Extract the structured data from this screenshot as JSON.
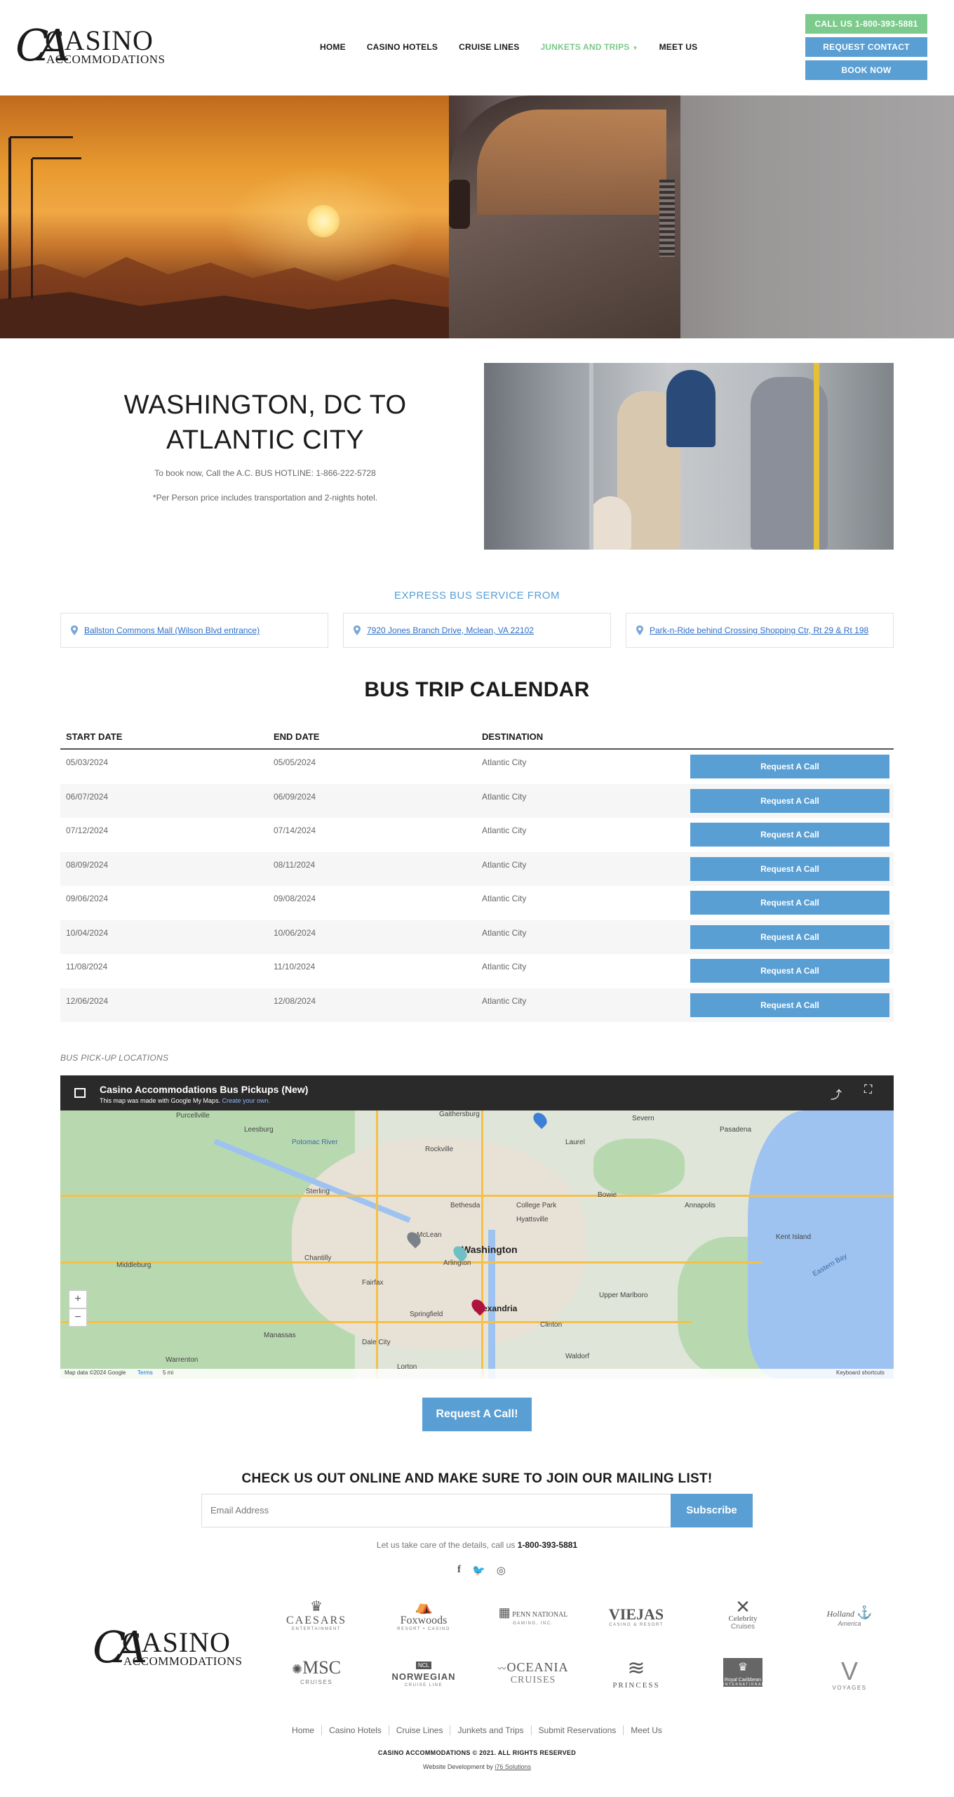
{
  "header": {
    "logo_mark": "CA",
    "logo_casino": "CASINO",
    "logo_accommodations": "ACCOMMODATIONS",
    "nav": [
      {
        "label": "HOME"
      },
      {
        "label": "CASINO HOTELS"
      },
      {
        "label": "CRUISE LINES"
      },
      {
        "label": "JUNKETS AND TRIPS"
      },
      {
        "label": "MEET US"
      }
    ],
    "call_label": "CALL US 1-800-393-5881",
    "request_label": "REQUEST CONTACT",
    "book_label": "BOOK NOW",
    "active_color": "#7cc98a"
  },
  "intro": {
    "title": "WASHINGTON, DC TO ATLANTIC CITY",
    "hotline": "To book now, Call the A.C. BUS HOTLINE: 1-866-222-5728",
    "note": "*Per Person price includes transportation and 2-nights hotel."
  },
  "express": {
    "heading": "EXPRESS BUS SERVICE FROM",
    "locations": [
      "Ballston Commons Mall (Wilson Blvd entrance)",
      "7920 Jones Branch Drive, Mclean, VA 22102",
      "Park-n-Ride behind Crossing Shopping Ctr, Rt 29 & Rt 198"
    ]
  },
  "calendar": {
    "title": "BUS TRIP CALENDAR",
    "headers": [
      "START DATE",
      "END DATE",
      "DESTINATION"
    ],
    "button_label": "Request A Call",
    "rows": [
      [
        "05/03/2024",
        "05/05/2024",
        "Atlantic City"
      ],
      [
        "06/07/2024",
        "06/09/2024",
        "Atlantic City"
      ],
      [
        "07/12/2024",
        "07/14/2024",
        "Atlantic City"
      ],
      [
        "08/09/2024",
        "08/11/2024",
        "Atlantic City"
      ],
      [
        "09/06/2024",
        "09/08/2024",
        "Atlantic City"
      ],
      [
        "10/04/2024",
        "10/06/2024",
        "Atlantic City"
      ],
      [
        "11/08/2024",
        "11/10/2024",
        "Atlantic City"
      ],
      [
        "12/06/2024",
        "12/08/2024",
        "Atlantic City"
      ]
    ]
  },
  "map": {
    "label": "BUS PICK-UP LOCATIONS",
    "title": "Casino Accommodations Bus Pickups (New)",
    "subtitle_prefix": "This map was made with Google My Maps.",
    "subtitle_link": "Create your own.",
    "footer_data": "Map data ©2024 Google",
    "footer_terms": "Terms",
    "footer_scale": "5 mi",
    "footer_shortcuts": "Keyboard shortcuts",
    "places": {
      "washington": "Washington",
      "arlington": "Arlington",
      "alexandria": "Alexandria",
      "mclean": "McLean",
      "bethesda": "Bethesda",
      "rockville": "Rockville",
      "gaithersburg": "Gaithersburg",
      "leesburg": "Leesburg",
      "laurel": "Laurel",
      "annapolis": "Annapolis",
      "columbia": "College Park",
      "bowie": "Bowie",
      "fairfax": "Fairfax",
      "springfield": "Springfield",
      "manassas": "Manassas",
      "potomac_river": "Potomac River",
      "severn": "Severn",
      "pasadena": "Pasadena",
      "chantilly": "Chantilly",
      "reston": "Sterling",
      "clinton": "Clinton",
      "waldorf": "Waldorf",
      "eastern_bay": "Eastern Bay",
      "kent_island": "Kent Island",
      "upper_marlboro": "Upper Marlboro",
      "purcellville": "Purcellville",
      "middleburg": "Middleburg",
      "warrenton": "Warrenton",
      "dale_city": "Dale City",
      "lorton": "Lorton",
      "silver_spring": "Hyattsville"
    }
  },
  "cta": {
    "label": "Request A Call!"
  },
  "mailing": {
    "heading": "CHECK US OUT ONLINE AND MAKE SURE TO JOIN OUR MAILING LIST!",
    "placeholder": "Email Address",
    "button": "Subscribe",
    "note_prefix": "Let us take care of the details, call us",
    "phone": "1-800-393-5881"
  },
  "partners": [
    {
      "name": "CAESARS",
      "sub": "ENTERTAINMENT",
      "mark": "♛"
    },
    {
      "name": "Foxwoods",
      "sub": "RESORT • CASINO",
      "mark": "⛺"
    },
    {
      "name": "PENN NATIONAL",
      "sub": "GAMING, INC.",
      "mark": "▦"
    },
    {
      "name": "VIEJAS",
      "sub": "CASINO & RESORT",
      "mark": ""
    },
    {
      "name": "Celebrity",
      "sub": "Cruises",
      "mark": "✕"
    },
    {
      "name": "Holland",
      "sub": "America",
      "mark": "⚓"
    },
    {
      "name": "MSC",
      "sub": "CRUISES",
      "mark": "✺"
    },
    {
      "name": "NORWEGIAN",
      "sub": "CRUISE LINE",
      "mark": "NCL"
    },
    {
      "name": "OCEANIA",
      "sub": "CRUISES",
      "mark": "〰"
    },
    {
      "name": "PRINCESS",
      "sub": "",
      "mark": "≋"
    },
    {
      "name": "Royal Caribbean",
      "sub": "INTERNATIONAL",
      "mark": "♛"
    },
    {
      "name": "VOYAGES",
      "sub": "",
      "mark": "V"
    }
  ],
  "footer": {
    "links": [
      "Home",
      "Casino Hotels",
      "Cruise Lines",
      "Junkets and Trips",
      "Submit Reservations",
      "Meet Us"
    ],
    "copyright": "CASINO ACCOMMODATIONS © 2021. ALL RIGHTS RESERVED",
    "dev_prefix": "Website Development by",
    "dev_link": "i76 Solutions"
  },
  "social_icons": [
    "facebook-icon",
    "twitter-icon",
    "instagram-icon"
  ],
  "colors": {
    "accent_blue": "#5a9fd4",
    "accent_green": "#7ccb8c",
    "link_blue": "#2f6fc8"
  }
}
